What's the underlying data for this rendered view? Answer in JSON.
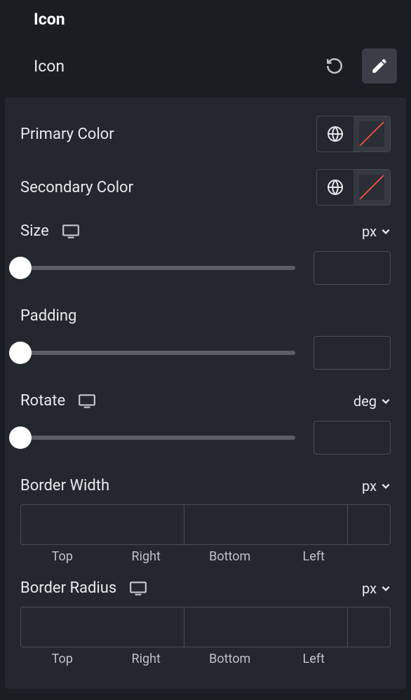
{
  "header": {
    "title": "Icon",
    "row_label": "Icon"
  },
  "panel": {
    "primary_color": {
      "label": "Primary Color"
    },
    "secondary_color": {
      "label": "Secondary Color"
    },
    "size": {
      "label": "Size",
      "unit": "px",
      "value": ""
    },
    "padding": {
      "label": "Padding",
      "value": ""
    },
    "rotate": {
      "label": "Rotate",
      "unit": "deg",
      "value": ""
    },
    "border_width": {
      "label": "Border Width",
      "unit": "px",
      "sides": {
        "top": "Top",
        "right": "Right",
        "bottom": "Bottom",
        "left": "Left"
      },
      "values": {
        "top": "",
        "right": "",
        "bottom": "",
        "left": ""
      }
    },
    "border_radius": {
      "label": "Border Radius",
      "unit": "px",
      "sides": {
        "top": "Top",
        "right": "Right",
        "bottom": "Bottom",
        "left": "Left"
      },
      "values": {
        "top": "",
        "right": "",
        "bottom": "",
        "left": ""
      }
    }
  },
  "icons": {
    "reset": "reset-icon",
    "edit": "edit-icon",
    "globe": "globe-icon",
    "desktop": "desktop-icon",
    "chevron": "chevron-down-icon",
    "link": "link-icon"
  }
}
